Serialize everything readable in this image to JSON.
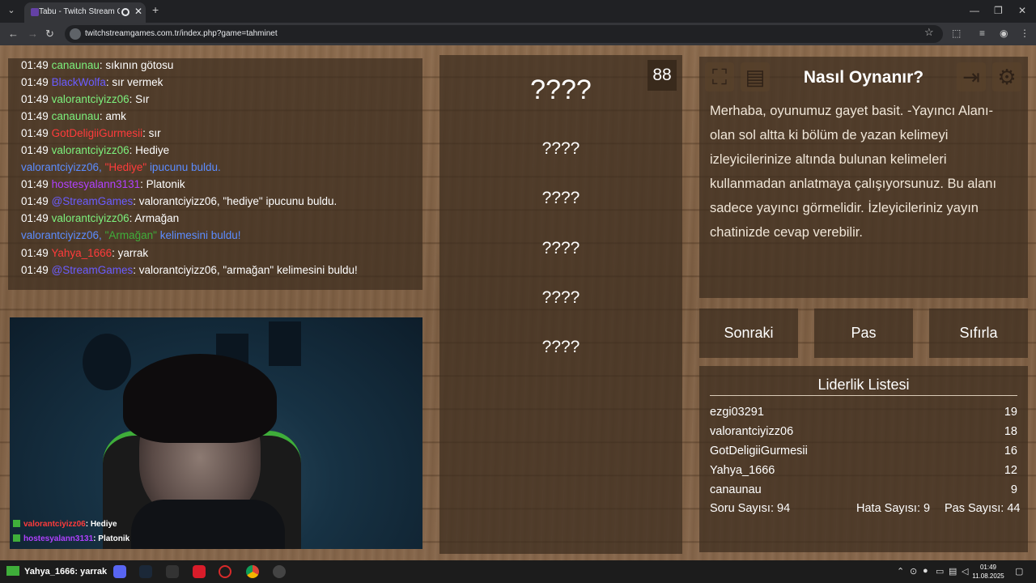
{
  "browser": {
    "tab_title": "Tabu - Twitch Stream Games",
    "url": "twitchstreamgames.com.tr/index.php?game=tahminet"
  },
  "chat": {
    "lines": [
      {
        "time": "01:49",
        "user": "canaunau",
        "user_color": "#7cf07c",
        "text": ": sıkının götosu"
      },
      {
        "time": "01:49",
        "user": "BlackWolfa",
        "user_color": "#6a5cff",
        "text": ": sır vermek"
      },
      {
        "time": "01:49",
        "user": "valorantciyizz06",
        "user_color": "#7cf07c",
        "text": ": Sır"
      },
      {
        "time": "01:49",
        "user": "canaunau",
        "user_color": "#7cf07c",
        "text": ": amk"
      },
      {
        "time": "01:49",
        "user": "GotDeligiiGurmesii",
        "user_color": "#ff3b3b",
        "text": ": sır"
      },
      {
        "time": "01:49",
        "user": "valorantciyizz06",
        "user_color": "#7cf07c",
        "text": ": Hediye"
      },
      {
        "time": "",
        "user": "valorantciyizz06,",
        "user_color": "#5b8cff",
        "text": ""
      },
      {
        "time": "01:49",
        "user": "hostesyalann3131",
        "user_color": "#b040ff",
        "text": ": Platonik"
      },
      {
        "time": "01:49",
        "user": "@StreamGames",
        "user_color": "#6a5cff",
        "text": ": valorantciyizz06, \"hediye\" ipucunu buldu."
      },
      {
        "time": "01:49",
        "user": "valorantciyizz06",
        "user_color": "#7cf07c",
        "text": ": Armağan"
      },
      {
        "time": "",
        "user": "valorantciyizz06,",
        "user_color": "#5b8cff",
        "text": ""
      },
      {
        "time": "01:49",
        "user": "Yahya_1666",
        "user_color": "#ff3b3b",
        "text": ": yarrak"
      },
      {
        "time": "01:49",
        "user": "@StreamGames",
        "user_color": "#6a5cff",
        "text": ": valorantciyizz06, \"armağan\" kelimesini buldu!"
      }
    ],
    "special_1": {
      "word": "\"Hediye\"",
      "word_color": "#ff3b3b",
      "rest": "ipucunu buldu."
    },
    "special_2": {
      "word": "\"Armağan\"",
      "word_color": "#3fae3a",
      "rest": "kelimesini buldu!"
    }
  },
  "webcam_overlay": [
    {
      "user": "valorantciyizz06",
      "user_color": "#ff3b3b",
      "text": ": Hediye"
    },
    {
      "user": "hostesyalann3131",
      "user_color": "#b040ff",
      "text": ": Platonik"
    },
    {
      "user": "valorantciyizz06",
      "user_color": "#ff3b3b",
      "text": ": Armağan"
    }
  ],
  "words": {
    "counter": "88",
    "main": "????",
    "list": [
      "????",
      "????",
      "????",
      "????",
      "????"
    ]
  },
  "howto": {
    "title": "Nasıl Oynanır?",
    "text": "Merhaba, oyunumuz gayet basit. -Yayıncı Alanı- olan sol altta ki bölüm de yazan kelimeyi izleyicilerinize altında bulunan kelimeleri kullanmadan anlatmaya çalışıyorsunuz. Bu alanı sadece yayıncı görmelidir. İzleyicileriniz yayın chatinizde cevap verebilir.",
    "icons": [
      "fullscreen-icon",
      "document-icon",
      "logout-icon",
      "gear-icon"
    ]
  },
  "buttons": {
    "next": "Sonraki",
    "pass": "Pas",
    "reset": "Sıfırla"
  },
  "leaderboard": {
    "title": "Liderlik Listesi",
    "rows": [
      {
        "name": "ezgi03291",
        "score": "19"
      },
      {
        "name": "valorantciyizz06",
        "score": "18"
      },
      {
        "name": "GotDeligiiGurmesii",
        "score": "16"
      },
      {
        "name": "Yahya_1666",
        "score": "12"
      },
      {
        "name": "canaunau",
        "score": "9"
      }
    ],
    "questions": "Soru Sayısı: 94",
    "errors": "Hata Sayısı: 9",
    "passes": "Pas Sayısı: 44"
  },
  "taskbar": {
    "chat_user": "Yahya_1666",
    "chat_text": ": yarrak",
    "time": "01:49",
    "date": "11.08.2025"
  }
}
